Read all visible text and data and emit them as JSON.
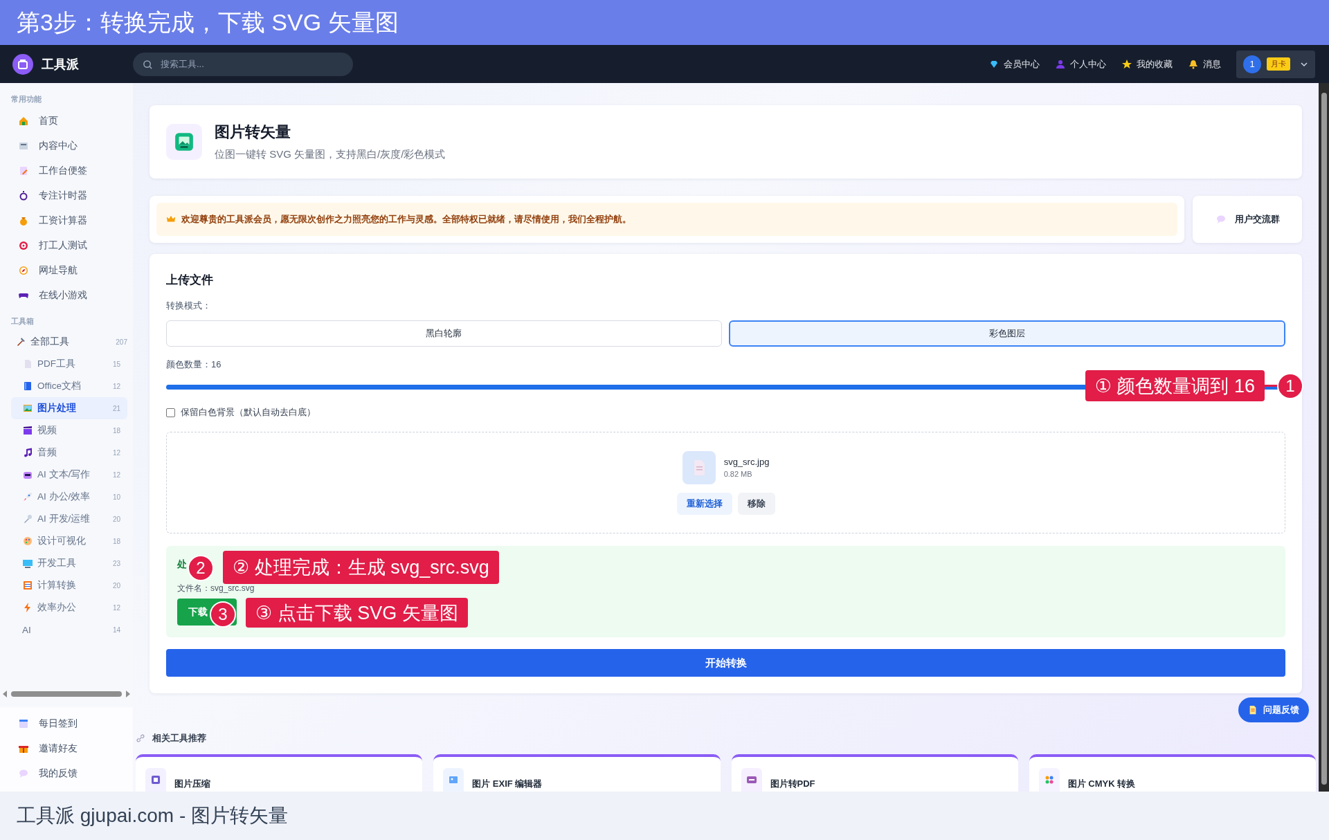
{
  "banner": {
    "title": "第3步：转换完成，下载 SVG 矢量图"
  },
  "navbar": {
    "brand": "工具派",
    "search": {
      "placeholder": "搜索工具..."
    },
    "links": [
      {
        "label": "会员中心"
      },
      {
        "label": "个人中心"
      },
      {
        "label": "我的收藏"
      },
      {
        "label": "消息"
      }
    ],
    "user": {
      "avatar": "1",
      "badge": "月卡"
    }
  },
  "sidebar": {
    "sections": [
      {
        "title": "常用功能",
        "items": [
          {
            "label": "首页"
          },
          {
            "label": "内容中心"
          },
          {
            "label": "工作台便签"
          },
          {
            "label": "专注计时器"
          },
          {
            "label": "工资计算器"
          },
          {
            "label": "打工人测试"
          },
          {
            "label": "网址导航"
          },
          {
            "label": "在线小游戏"
          }
        ]
      },
      {
        "title": "工具箱",
        "tools": {
          "label": "全部工具",
          "count": "207",
          "children": [
            {
              "label": "PDF工具",
              "count": "15",
              "selected": false
            },
            {
              "label": "Office文档",
              "count": "12",
              "selected": false
            },
            {
              "label": "图片处理",
              "count": "21",
              "selected": true
            },
            {
              "label": "视频",
              "count": "18",
              "selected": false
            },
            {
              "label": "音频",
              "count": "12",
              "selected": false
            },
            {
              "label": "AI 文本/写作",
              "count": "12",
              "selected": false
            },
            {
              "label": "AI 办公/效率",
              "count": "10",
              "selected": false
            },
            {
              "label": "AI 开发/运维",
              "count": "20",
              "selected": false
            },
            {
              "label": "设计可视化",
              "count": "18",
              "selected": false
            },
            {
              "label": "开发工具",
              "count": "23",
              "selected": false
            },
            {
              "label": "计算转换",
              "count": "20",
              "selected": false
            },
            {
              "label": "效率办公",
              "count": "12",
              "selected": false
            },
            {
              "label": "AI",
              "count": "14",
              "selected": false
            }
          ]
        }
      }
    ],
    "footer_items": [
      {
        "label": "每日签到"
      },
      {
        "label": "邀请好友"
      },
      {
        "label": "我的反馈"
      }
    ]
  },
  "header_card": {
    "title": "图片转矢量",
    "subtitle": "位图一键转 SVG 矢量图，支持黑白/灰度/彩色模式"
  },
  "notice": {
    "text": "欢迎尊贵的工具派会员，愿无限次创作之力照亮您的工作与灵感。全部特权已就绪，请尽情使用，我们全程护航。",
    "side_button": "用户交流群"
  },
  "upload": {
    "title": "上传文件",
    "mode_label": "转换模式：",
    "modes": [
      {
        "label": "黑白轮廓",
        "selected": false
      },
      {
        "label": "彩色图层",
        "selected": true
      }
    ],
    "color_count_label": "颜色数量：16",
    "slider": {
      "level": 1
    },
    "keep_white": {
      "label": "保留白色背景（默认自动去白底）",
      "checked": false
    },
    "file": {
      "name": "svg_src.jpg",
      "size": "0.82 MB",
      "actions": [
        "重新选择",
        "移除"
      ]
    },
    "result": {
      "title": "处",
      "filename": "文件名：svg_src.svg",
      "download": "下载"
    },
    "start_button": "开始转换"
  },
  "callouts": [
    {
      "number": "1",
      "text": "① 颜色数量调到 16"
    },
    {
      "number": "2",
      "text": "② 处理完成：生成 svg_src.svg"
    },
    {
      "number": "3",
      "text": "③ 点击下载 SVG 矢量图"
    }
  ],
  "feedback_button": "问题反馈",
  "related": {
    "title": "相关工具推荐",
    "cards": [
      {
        "title": "图片压缩"
      },
      {
        "title": "图片 EXIF 编辑器"
      },
      {
        "title": "图片转PDF"
      },
      {
        "title": "图片 CMYK 转换"
      }
    ]
  },
  "caption": "工具派 gjupai.com - 图片转矢量"
}
